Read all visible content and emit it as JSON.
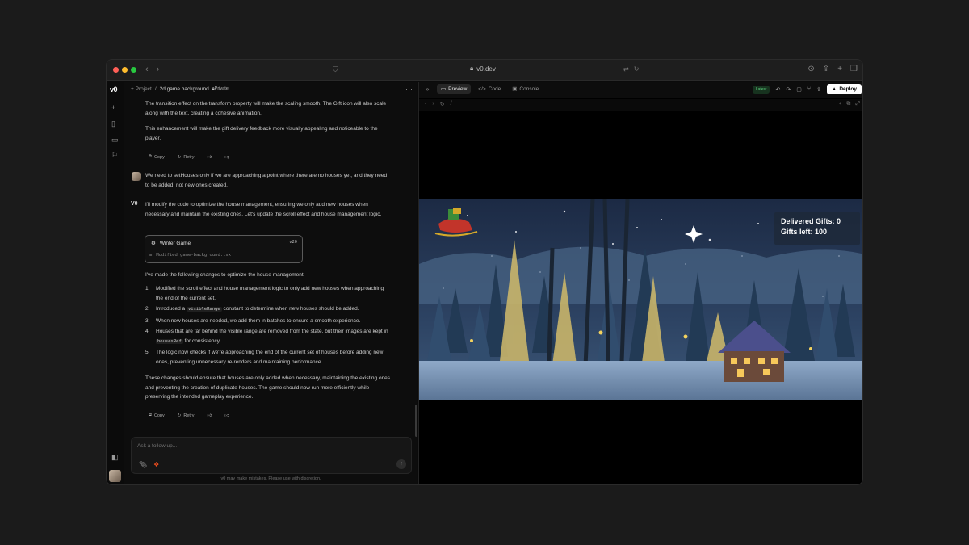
{
  "browser": {
    "url": "v0.dev",
    "colors": {
      "close": "#ff5f57",
      "minimize": "#febc2e",
      "maximize": "#28c840"
    }
  },
  "rail": {
    "logo": "v0",
    "icons": [
      "plus-icon",
      "book-icon",
      "folder-icon",
      "flag-icon",
      "sidebar-icon"
    ]
  },
  "chat": {
    "breadcrumb": {
      "root": "Project",
      "separator": "/",
      "project": "2d game background",
      "visibility": "Private"
    },
    "messages": {
      "intro_p1": "The transition effect on the transform property will make the scaling smooth. The Gift icon will also scale along with the text, creating a cohesive animation.",
      "intro_p2": "This enhancement will make the gift delivery feedback more visually appealing and noticeable to the player.",
      "user_msg": "We need to setHouses only if we are approaching a point where there are no houses yet, and they need to be added, not new ones created.",
      "assistant_p1": "I'll modify the code to optimize the house management, ensuring we only add new houses when necessary and maintain the existing ones. Let's update the scroll effect and house management logic.",
      "card": {
        "title": "Winter Game",
        "version": "v20",
        "file": "Modified game-background.tsx"
      },
      "list_intro": "I've made the following changes to optimize the house management:",
      "list": [
        {
          "num": "1.",
          "parts": [
            "Modified the scroll effect and house management logic to only add new houses when approaching the end of the current set."
          ]
        },
        {
          "num": "2.",
          "parts": [
            "Introduced a ",
            "visibleRange",
            " constant to determine when new houses should be added."
          ]
        },
        {
          "num": "3.",
          "parts": [
            "When new houses are needed, we add them in batches to ensure a smooth experience."
          ]
        },
        {
          "num": "4.",
          "parts": [
            "Houses that are far behind the visible range are removed from the state, but their images are kept in ",
            "housesRef",
            " for consistency."
          ]
        },
        {
          "num": "5.",
          "parts": [
            "The logic now checks if we're approaching the end of the current set of houses before adding new ones, preventing unnecessary re-renders and maintaining performance."
          ]
        }
      ],
      "closing": "These changes should ensure that houses are only added when necessary, maintaining the existing ones and preventing the creation of duplicate houses. The game should now run more efficiently while preserving the intended gameplay experience."
    },
    "actions": {
      "copy": "Copy",
      "retry": "Retry"
    },
    "composer": {
      "placeholder": "Ask a follow up..."
    },
    "disclaimer": "v0 may make mistakes. Please use with discretion."
  },
  "preview": {
    "tabs": [
      {
        "label": "Preview",
        "icon": "preview-icon",
        "active": true
      },
      {
        "label": "Code",
        "icon": "code-icon",
        "active": false
      },
      {
        "label": "Console",
        "icon": "console-icon",
        "active": false
      }
    ],
    "latest": "Latest",
    "deploy": "Deploy",
    "path": "/",
    "hud": {
      "delivered": "Delivered Gifts: 0",
      "left": "Gifts left: 100"
    }
  }
}
